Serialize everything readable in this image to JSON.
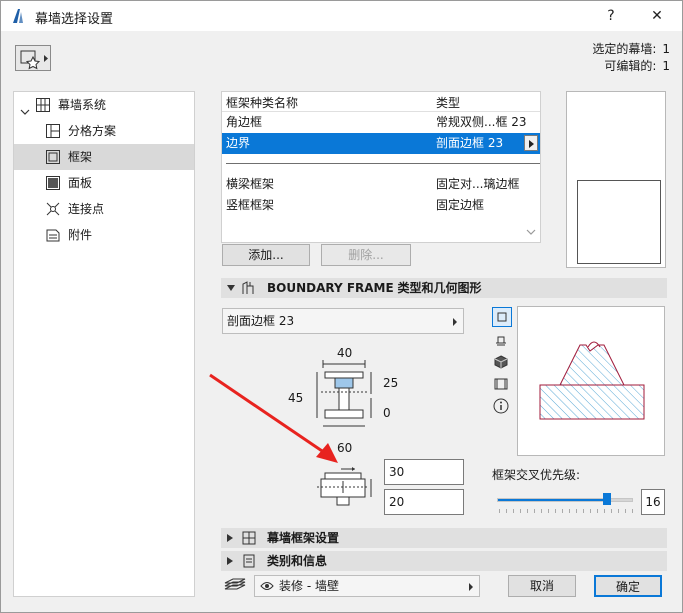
{
  "window": {
    "title": "幕墙选择设置",
    "help_label": "?",
    "close_label": "✕"
  },
  "selection": {
    "selected_label": "选定的幕墙:",
    "selected_count": "1",
    "editable_label": "可编辑的:",
    "editable_count": "1"
  },
  "sidebar": {
    "items": [
      {
        "label": "幕墙系统",
        "icon": "grid-icon"
      },
      {
        "label": "分格方案",
        "icon": "scheme-icon"
      },
      {
        "label": "框架",
        "icon": "frame-icon"
      },
      {
        "label": "面板",
        "icon": "panel-icon"
      },
      {
        "label": "连接点",
        "icon": "junction-icon"
      },
      {
        "label": "附件",
        "icon": "accessory-icon"
      }
    ]
  },
  "frame_list": {
    "headers": {
      "name": "框架种类名称",
      "type": "类型"
    },
    "rows": [
      {
        "name": "角边框",
        "type": "常规双侧...框 23"
      },
      {
        "name": "边界",
        "type": "剖面边框 23"
      },
      {
        "name": "横梁框架",
        "type": "固定对...璃边框"
      },
      {
        "name": "竖框框架",
        "type": "固定边框"
      }
    ]
  },
  "list_buttons": {
    "add": "添加...",
    "delete": "删除..."
  },
  "boundary_section": {
    "title": "BOUNDARY FRAME",
    "subtitle": "类型和几何图形",
    "type_value": "剖面边框 23"
  },
  "dimensions": {
    "top": "40",
    "left": "45",
    "right_top": "25",
    "right_bottom": "0",
    "bottom": "60"
  },
  "inputs": {
    "width": "30",
    "depth": "20"
  },
  "priority": {
    "label": "框架交叉优先级:",
    "value": "16",
    "fraction": 0.81
  },
  "sections": {
    "frame_settings": "幕墙框架设置",
    "classification": "类别和信息"
  },
  "footer": {
    "layer_value": "装修 - 墙壁",
    "cancel": "取消",
    "ok": "确定"
  },
  "colors": {
    "accent": "#0a78d7",
    "selected_row": "#0a78d7",
    "hatch": "#5aa9d6",
    "profile_line": "#a01a3a"
  }
}
